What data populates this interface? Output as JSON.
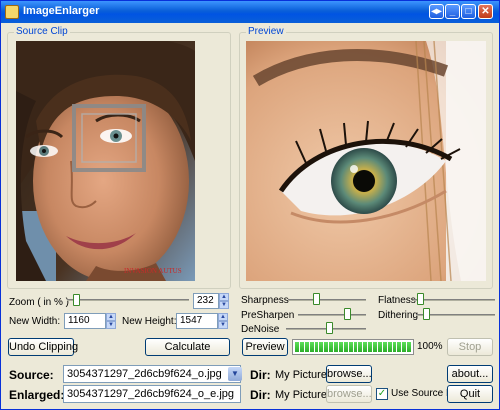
{
  "window": {
    "title": "ImageEnlarger"
  },
  "source_clip": {
    "label": "Source Clip",
    "watermark": "INVASION AUTUS"
  },
  "preview": {
    "label": "Preview"
  },
  "zoom": {
    "label": "Zoom ( in % )",
    "value": "232"
  },
  "new_width": {
    "label": "New Width:",
    "value": "1160"
  },
  "new_height": {
    "label": "New Height:",
    "value": "1547"
  },
  "buttons": {
    "undo_clipping": "Undo Clipping",
    "calculate": "Calculate",
    "preview": "Preview",
    "stop": "Stop",
    "about": "about...",
    "browse_source": "browse...",
    "browse_enlarged": "browse...",
    "quit": "Quit"
  },
  "sliders": {
    "sharpness": {
      "label": "Sharpness",
      "level": 0.35
    },
    "presharpen": {
      "label": "PreSharpen",
      "level": 0.75
    },
    "denoise": {
      "label": "DeNoise",
      "level": 0.55
    },
    "flatness": {
      "label": "Flatness",
      "level": 0.05
    },
    "dithering": {
      "label": "Dithering",
      "level": 0.1
    }
  },
  "progress": {
    "value": 1.0,
    "text": "100%"
  },
  "source": {
    "label": "Source:",
    "value": "3054371297_2d6cb9f624_o.jpg"
  },
  "enlarged": {
    "label": "Enlarged:",
    "value": "3054371297_2d6cb9f624_o_e.jpg"
  },
  "dir_source": {
    "label": "Dir:",
    "value": "My Pictures"
  },
  "dir_enlarged": {
    "label": "Dir:",
    "value": "My Pictures"
  },
  "use_source_dir": {
    "label": "Use Source Dir.",
    "checked": true
  },
  "colors": {
    "accent": "#0054e3",
    "progress": "#2cae28",
    "group_label": "#0046d5"
  },
  "icons": [
    "app-icon",
    "restore-icon",
    "minimize-icon",
    "maximize-icon",
    "close-icon"
  ]
}
